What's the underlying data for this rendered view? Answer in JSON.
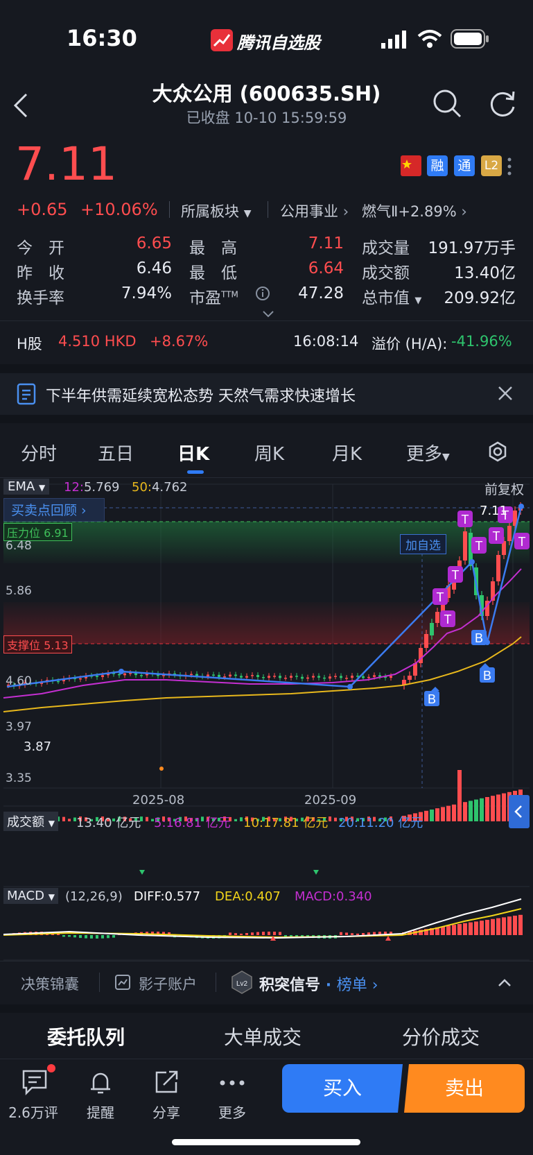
{
  "status_bar": {
    "time": "16:30",
    "app_name": "腾讯自选股"
  },
  "header": {
    "title": "大众公用 (600635.SH)",
    "subtitle": "已收盘   10-10 15:59:59"
  },
  "quote": {
    "price": "7.11",
    "change": "+0.65",
    "change_pct": "+10.06%",
    "sector_label": "所属板块",
    "sector1": "公用事业",
    "sector2": "燃气Ⅱ",
    "sector2_pct": "+2.89%",
    "badges": [
      "融",
      "通",
      "L2"
    ],
    "stats": [
      {
        "label": "今　开",
        "value": "6.65"
      },
      {
        "label": "昨　收",
        "value": "6.46"
      },
      {
        "label": "换手率",
        "value": "7.94%"
      },
      {
        "label": "最　高",
        "value": "7.11"
      },
      {
        "label": "最　低",
        "value": "6.64"
      },
      {
        "label": "市盈",
        "sup": "TTM",
        "value": "47.28"
      },
      {
        "label": "成交量",
        "value": "191.97万手"
      },
      {
        "label": "成交额",
        "value": "13.40亿"
      },
      {
        "label": "总市值",
        "value": "209.92亿"
      }
    ],
    "h_share": {
      "label": "H股",
      "price": "4.510 HKD",
      "pct": "+8.67%",
      "time": "16:08:14",
      "premium_label": "溢价 (H/A):",
      "premium": "-41.96%"
    }
  },
  "news": {
    "text": "下半年供需延续宽松态势 天然气需求快速增长"
  },
  "tabs": {
    "items": [
      "分时",
      "五日",
      "日K",
      "周K",
      "月K",
      "更多"
    ],
    "active": 2
  },
  "chart": {
    "ema_label": "EMA",
    "ema12_label": "12:",
    "ema12": "5.769",
    "ema50_label": "50:",
    "ema50": "4.762",
    "adjust": "前复权",
    "review": "买卖点回顾",
    "resistance": "压力位 6.91",
    "support": "支撑位 5.13",
    "add_watch": "加自选",
    "last_price_label": "7.11",
    "low_label": "3.87",
    "y_ticks": [
      "6.48",
      "5.86",
      "4.60",
      "3.97",
      "3.35"
    ],
    "x_ticks": [
      "2025-08",
      "2025-09"
    ],
    "vol_label": "成交额",
    "vol_value": "13.40 亿元",
    "vol_ma5": "5:16.81 亿元",
    "vol_ma10": "10:17.81 亿元",
    "vol_ma20": "20:11.20 亿元",
    "macd_label": "MACD",
    "macd_params": "(12,26,9)",
    "diff": "DIFF:0.577",
    "dea": "DEA:0.407",
    "macd": "MACD:0.340",
    "buy": "B",
    "sell": "T"
  },
  "tools": {
    "items": [
      "决策锦囊",
      "影子账户",
      "积突信号",
      "榜单"
    ]
  },
  "orders": {
    "tabs": [
      "委托队列",
      "大单成交",
      "分价成交"
    ]
  },
  "bottom": {
    "comments": "2.6万评",
    "remind": "提醒",
    "share": "分享",
    "more": "更多",
    "buy": "买入",
    "sell": "卖出"
  },
  "colors": {
    "up": "#ff4d4f",
    "down": "#2ec46d",
    "accent": "#2f7bf5",
    "sell_btn": "#ff8a1f"
  }
}
